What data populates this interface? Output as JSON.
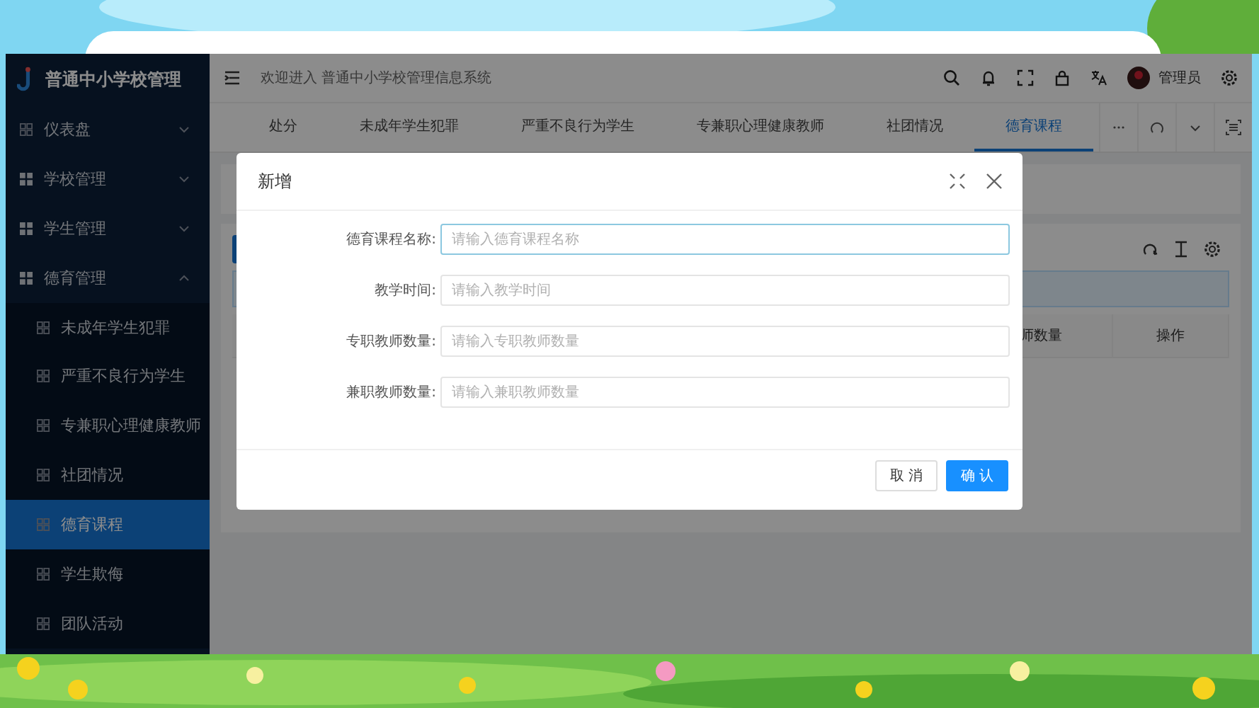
{
  "sidebar": {
    "title": "普通中小学校管理",
    "items": [
      {
        "label": "仪表盘",
        "expanded": false,
        "selected": false
      },
      {
        "label": "学校管理",
        "expanded": false,
        "selected": false
      },
      {
        "label": "学生管理",
        "expanded": false,
        "selected": false
      },
      {
        "label": "德育管理",
        "expanded": true,
        "selected": false,
        "children": [
          {
            "label": "未成年学生犯罪",
            "selected": false
          },
          {
            "label": "严重不良行为学生",
            "selected": false
          },
          {
            "label": "专兼职心理健康教师",
            "selected": false
          },
          {
            "label": "社团情况",
            "selected": false
          },
          {
            "label": "德育课程",
            "selected": true
          },
          {
            "label": "学生欺侮",
            "selected": false
          },
          {
            "label": "团队活动",
            "selected": false
          }
        ]
      }
    ]
  },
  "header": {
    "welcome": "欢迎进入 普通中小学校管理信息系统",
    "user": "管理员"
  },
  "tabs": [
    {
      "label": "处分",
      "selected": false
    },
    {
      "label": "未成年学生犯罪",
      "selected": false
    },
    {
      "label": "严重不良行为学生",
      "selected": false
    },
    {
      "label": "专兼职心理健康教师",
      "selected": false
    },
    {
      "label": "社团情况",
      "selected": false
    },
    {
      "label": "德育课程",
      "selected": true
    }
  ],
  "table": {
    "columns": [
      "师数量",
      "操作"
    ]
  },
  "dialog": {
    "title": "新增",
    "fields": [
      {
        "label": "德育课程名称:",
        "placeholder": "请输入德育课程名称",
        "focused": true
      },
      {
        "label": "教学时间:",
        "placeholder": "请输入教学时间",
        "focused": false
      },
      {
        "label": "专职教师数量:",
        "placeholder": "请输入专职教师数量",
        "focused": false
      },
      {
        "label": "兼职教师数量:",
        "placeholder": "请输入兼职教师数量",
        "focused": false
      }
    ],
    "buttons": [
      {
        "label": "取 消",
        "kind": "default"
      },
      {
        "label": "确 认",
        "kind": "primary"
      }
    ]
  }
}
